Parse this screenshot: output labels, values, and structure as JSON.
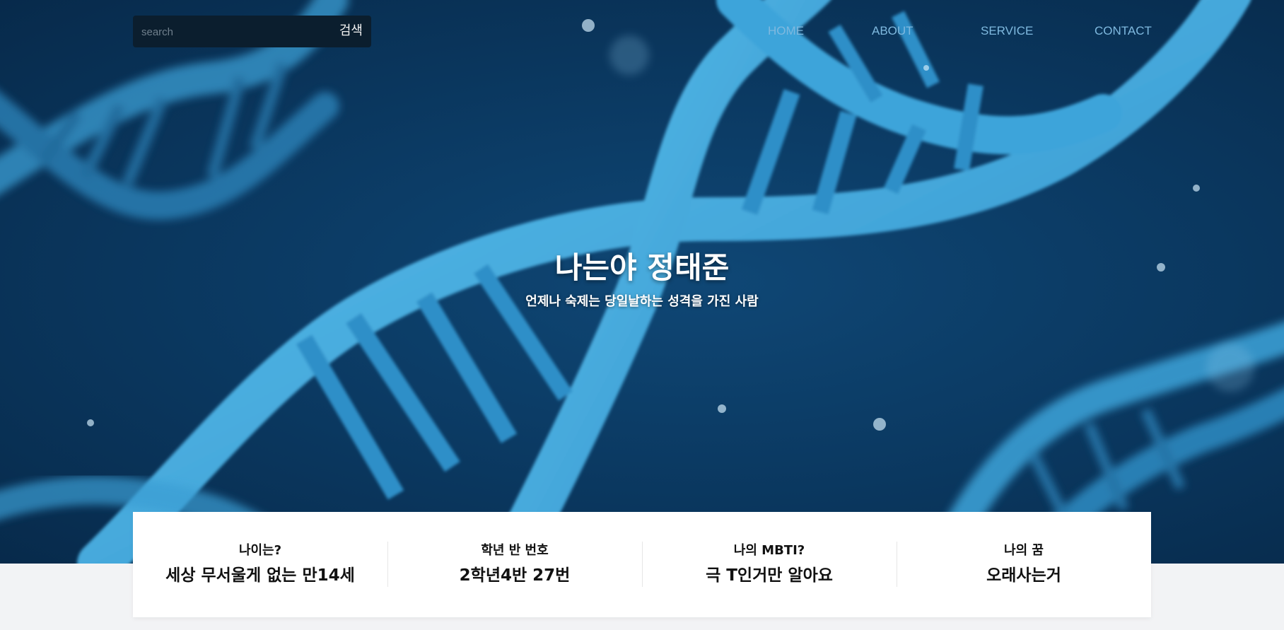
{
  "search": {
    "placeholder": "search",
    "button_label": "검색"
  },
  "nav": {
    "items": [
      {
        "label": "HOME"
      },
      {
        "label": "ABOUT"
      },
      {
        "label": "SERVICE"
      },
      {
        "label": "CONTACT"
      }
    ]
  },
  "hero": {
    "title": "나는야 정태준",
    "subtitle": "언제나 숙제는 당일날하는 성격을 가진 사람",
    "background": "dna-helix-image"
  },
  "info": {
    "items": [
      {
        "label": "나이는?",
        "value": "세상 무서울게 없는 만14세"
      },
      {
        "label": "학년 반 번호",
        "value": "2학년4반 27번"
      },
      {
        "label": "나의 MBTI?",
        "value": "극 T인거만 알아요"
      },
      {
        "label": "나의 꿈",
        "value": "오래사는거"
      }
    ]
  },
  "colors": {
    "hero_bg": "#0b3a63",
    "dna": "#3aa3d9",
    "nav_link": "#7fb9df",
    "search_bg": "#0b1e2e",
    "page_bg": "#f2f3f5"
  }
}
